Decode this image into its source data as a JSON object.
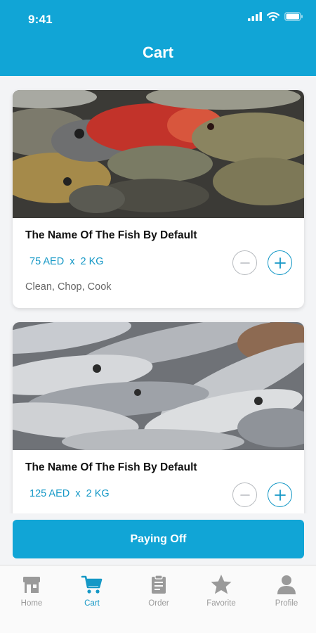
{
  "status_bar": {
    "time": "9:41"
  },
  "header": {
    "title": "Cart"
  },
  "cart_items": [
    {
      "name": "The Name Of The Fish By Default",
      "price": "75 AED",
      "separator": "x",
      "quantity": "2 KG",
      "options": "Clean, Chop, Cook",
      "image": "red-grouper-fish-photo"
    },
    {
      "name": "The Name Of The Fish By Default",
      "price": "125 AED",
      "separator": "x",
      "quantity": "2 KG",
      "options": "",
      "image": "mackerel-fish-photo"
    }
  ],
  "pay_button": {
    "label": "Paying Off"
  },
  "tabs": [
    {
      "label": "Home",
      "icon": "shop-icon",
      "active": false
    },
    {
      "label": "Cart",
      "icon": "cart-icon",
      "active": true
    },
    {
      "label": "Order",
      "icon": "clipboard-icon",
      "active": false
    },
    {
      "label": "Favorite",
      "icon": "star-icon",
      "active": false
    },
    {
      "label": "Profile",
      "icon": "person-icon",
      "active": false
    }
  ],
  "colors": {
    "primary": "#11a5d6",
    "accent_text": "#1598c6",
    "inactive": "#9a9a9a",
    "background": "#f3f4f6"
  }
}
